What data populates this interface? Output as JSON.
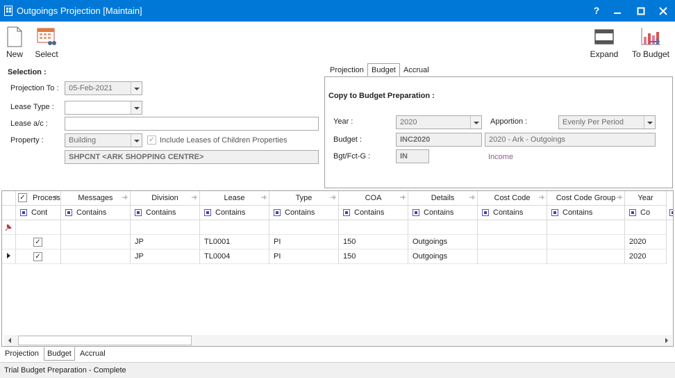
{
  "window": {
    "title": "Outgoings Projection [Maintain]",
    "help_label": "?",
    "accent": "#0078d7"
  },
  "toolbar": {
    "new_label": "New",
    "select_label": "Select",
    "expand_label": "Expand",
    "to_budget_label": "To Budget"
  },
  "selection": {
    "title": "Selection :",
    "projection_to_label": "Projection To :",
    "projection_to_value": "05-Feb-2021",
    "lease_type_label": "Lease Type :",
    "lease_type_value": "",
    "lease_ac_label": "Lease a/c :",
    "lease_ac_value": "",
    "property_label": "Property :",
    "property_value": "Building",
    "include_children_label": "Include Leases of Children Properties",
    "include_children_checked": true,
    "property_desc": "SHPCNT <ARK SHOPPING CENTRE>"
  },
  "top_tabs": [
    "Projection",
    "Budget",
    "Accrual"
  ],
  "top_tabs_active": "Budget",
  "budget": {
    "title": "Copy to Budget Preparation :",
    "year_label": "Year :",
    "year_value": "2020",
    "apportion_label": "Apportion :",
    "apportion_value": "Evenly Per Period",
    "budget_label": "Budget :",
    "budget_code": "INC2020",
    "budget_desc": "2020 - Ark - Outgoings",
    "bgt_label": "Bgt/Fct-G :",
    "bgt_code": "IN",
    "bgt_desc": "Income",
    "bgt_desc_color": "#8b5a8b"
  },
  "grid": {
    "columns": [
      "Process",
      "Messages",
      "Division",
      "Lease",
      "Type",
      "COA",
      "Details",
      "Cost Code",
      "Cost Code Group",
      "Year"
    ],
    "filters": [
      "Cont",
      "Contains",
      "Contains",
      "Contains",
      "Contains",
      "Contains",
      "Contains",
      "Contains",
      "Contains",
      "Co"
    ],
    "rows": [
      {
        "process": true,
        "messages": "",
        "division": "JP",
        "lease": "TL0001",
        "type": "PI",
        "coa": "150",
        "details": "Outgoings",
        "cost_code": "",
        "cost_code_group": "",
        "year": "2020"
      },
      {
        "process": true,
        "messages": "",
        "division": "JP",
        "lease": "TL0004",
        "type": "PI",
        "coa": "150",
        "details": "Outgoings",
        "cost_code": "",
        "cost_code_group": "",
        "year": "2020"
      }
    ]
  },
  "bottom_tabs": [
    "Projection",
    "Budget",
    "Accrual"
  ],
  "bottom_tabs_active": "Budget",
  "status": "Trial Budget Preparation - Complete"
}
